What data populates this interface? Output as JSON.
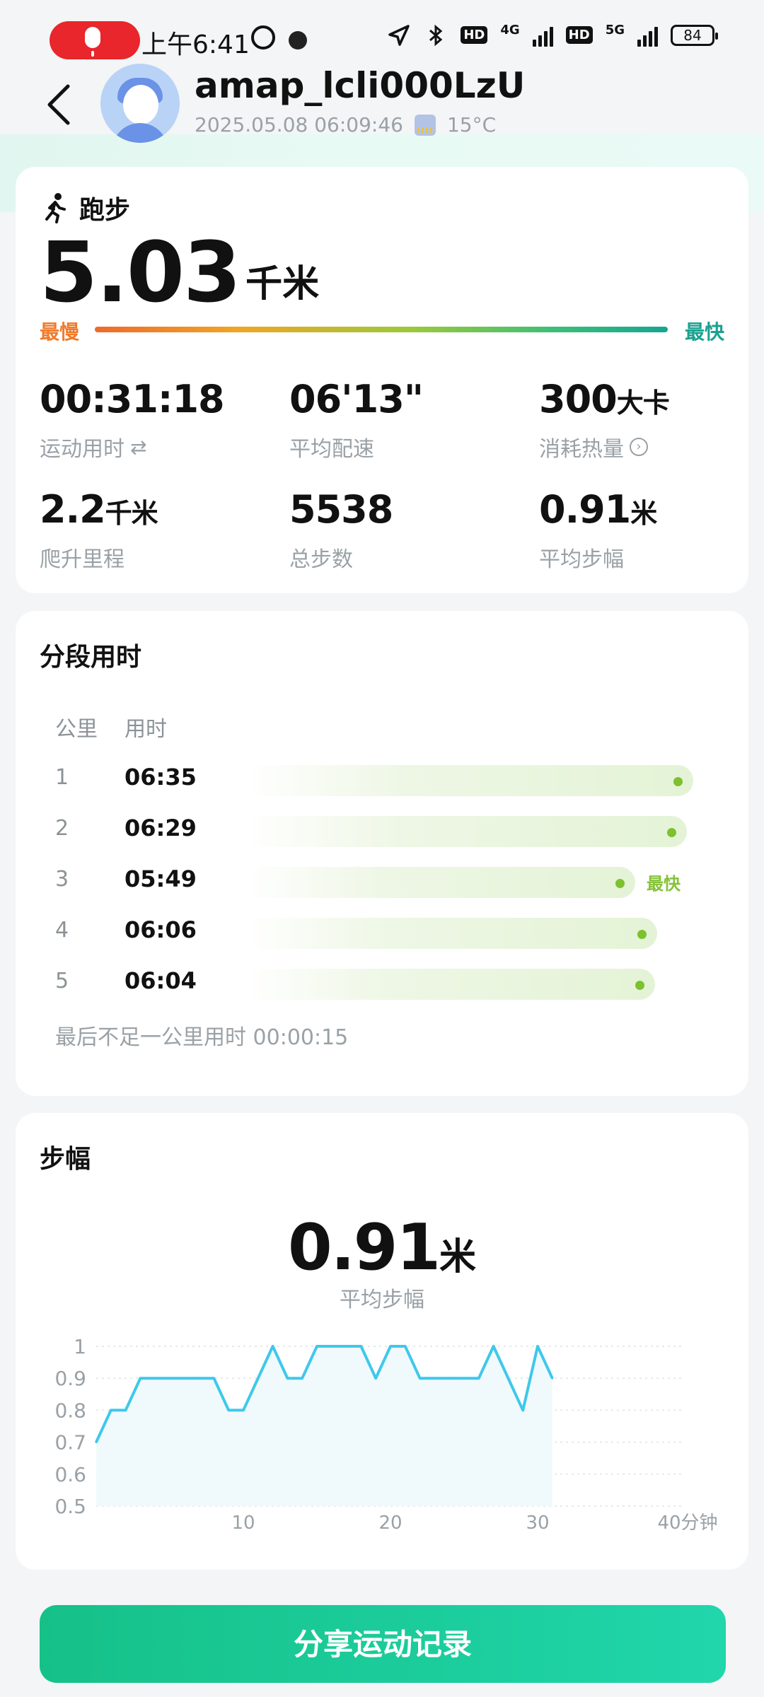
{
  "status_bar": {
    "time": "上午6:41",
    "net1": "4G",
    "net2": "5G",
    "hd": "HD",
    "battery": "84"
  },
  "header": {
    "username": "amap_lcli000LzU",
    "datetime": "2025.05.08 06:09:46",
    "temperature": "15°C"
  },
  "summary": {
    "sport_label": "跑步",
    "distance_value": "5.03",
    "distance_unit": "千米",
    "slowest_label": "最慢",
    "fastest_label": "最快",
    "stats": [
      {
        "value": "00:31:18",
        "unit": "",
        "label": "运动用时"
      },
      {
        "value": "06'13\"",
        "unit": "",
        "label": "平均配速"
      },
      {
        "value": "300",
        "unit": "大卡",
        "label": "消耗热量"
      },
      {
        "value": "2.2",
        "unit": "千米",
        "label": "爬升里程"
      },
      {
        "value": "5538",
        "unit": "",
        "label": "总步数"
      },
      {
        "value": "0.91",
        "unit": "米",
        "label": "平均步幅"
      }
    ]
  },
  "splits": {
    "title": "分段用时",
    "col_km": "公里",
    "col_time": "用时",
    "rows": [
      {
        "km": "1",
        "time": "06:35",
        "fraction": 1.0
      },
      {
        "km": "2",
        "time": "06:29",
        "fraction": 0.985
      },
      {
        "km": "3",
        "time": "05:49",
        "fraction": 0.87,
        "badge": "最快"
      },
      {
        "km": "4",
        "time": "06:06",
        "fraction": 0.92
      },
      {
        "km": "5",
        "time": "06:04",
        "fraction": 0.915
      }
    ],
    "note": "最后不足一公里用时 00:00:15"
  },
  "stride": {
    "title": "步幅",
    "avg_value": "0.91",
    "avg_unit": "米",
    "avg_label": "平均步幅"
  },
  "chart_data": {
    "type": "area",
    "x_unit": "分钟",
    "x_ticks": [
      10,
      20,
      30,
      40
    ],
    "x_tick_labels": [
      "10",
      "20",
      "30",
      "40分钟"
    ],
    "y_ticks": [
      1,
      0.9,
      0.8,
      0.7,
      0.6,
      0.5
    ],
    "y_tick_labels": [
      "1",
      "0.9",
      "0.8",
      "0.7",
      "0.6",
      "0.5"
    ],
    "xlim": [
      0,
      40
    ],
    "ylim": [
      0.5,
      1.0
    ],
    "x": [
      0,
      1,
      2,
      3,
      4,
      5,
      6,
      7,
      8,
      9,
      10,
      11,
      12,
      13,
      14,
      15,
      16,
      17,
      18,
      19,
      20,
      21,
      22,
      23,
      24,
      25,
      26,
      27,
      28,
      29,
      30,
      31
    ],
    "values": [
      0.7,
      0.8,
      0.8,
      0.9,
      0.9,
      0.9,
      0.9,
      0.9,
      0.9,
      0.8,
      0.8,
      0.9,
      1.0,
      0.9,
      0.9,
      1.0,
      1.0,
      1.0,
      1.0,
      0.9,
      1.0,
      1.0,
      0.9,
      0.9,
      0.9,
      0.9,
      0.9,
      1.0,
      0.9,
      0.8,
      1.0,
      0.9
    ],
    "line_color": "#3fc8ea",
    "grid": true
  },
  "share_button": "分享运动记录",
  "colors": {
    "slow": "#ef7b2b",
    "fast": "#1aa190",
    "accent": "#16c188",
    "split_dot": "#7cc12f"
  }
}
